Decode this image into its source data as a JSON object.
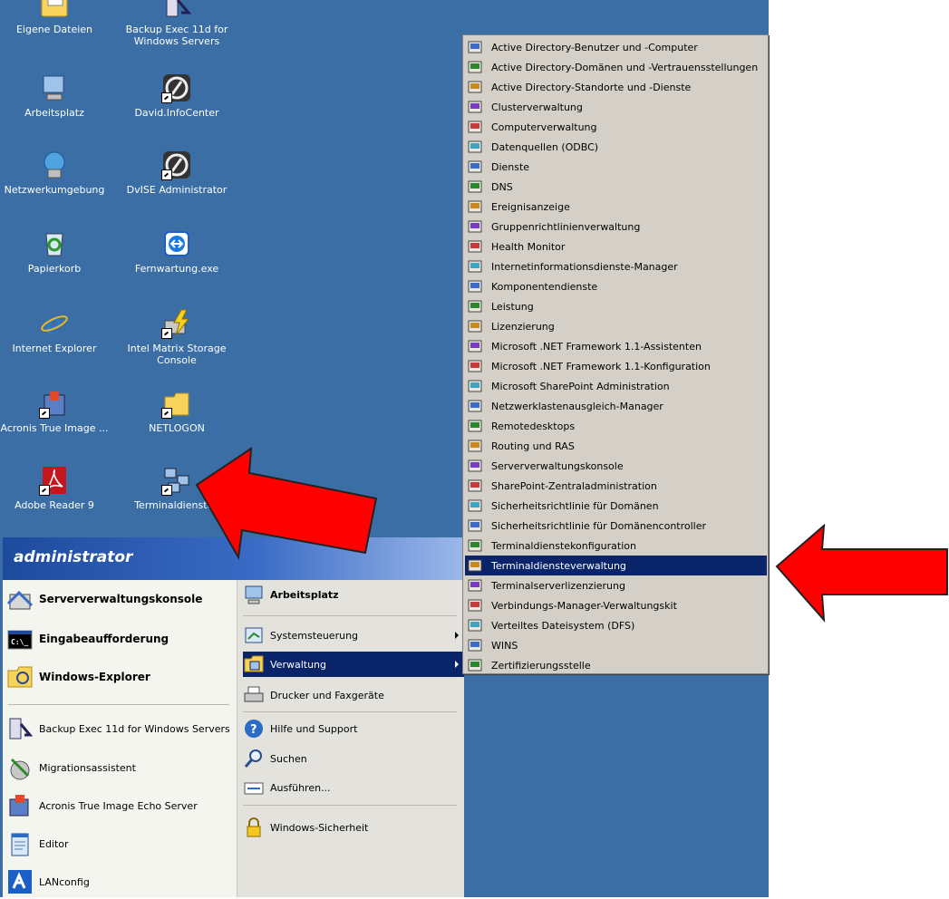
{
  "desktop": {
    "icons": [
      {
        "label": "Eigene Dateien",
        "icon": "folder-documents-icon"
      },
      {
        "label": "Backup Exec 11d for Windows Servers",
        "icon": "backup-exec-icon"
      },
      {
        "label": "Arbeitsplatz",
        "icon": "my-computer-icon"
      },
      {
        "label": "David.InfoCenter",
        "icon": "david-infocenter-icon"
      },
      {
        "label": "Netzwerkumgebung",
        "icon": "network-places-icon"
      },
      {
        "label": "DvISE Administrator",
        "icon": "dvise-admin-icon"
      },
      {
        "label": "Papierkorb",
        "icon": "recycle-bin-icon"
      },
      {
        "label": "Fernwartung.exe",
        "icon": "teamviewer-icon"
      },
      {
        "label": "Internet Explorer",
        "icon": "internet-explorer-icon"
      },
      {
        "label": "Intel Matrix Storage Console",
        "icon": "intel-storage-icon"
      },
      {
        "label": "Acronis True Image ...",
        "icon": "acronis-icon"
      },
      {
        "label": "NETLOGON",
        "icon": "folder-icon"
      },
      {
        "label": "Adobe Reader 9",
        "icon": "adobe-reader-icon"
      },
      {
        "label": "Terminaldienstev",
        "icon": "terminal-services-icon"
      }
    ]
  },
  "start_menu": {
    "user": "administrator",
    "left_items": [
      {
        "label": "Serververwaltungskonsole",
        "icon": "server-management-icon",
        "bold": true
      },
      {
        "label": "Eingabeaufforderung",
        "icon": "command-prompt-icon",
        "bold": true
      },
      {
        "label": "Windows-Explorer",
        "icon": "windows-explorer-icon",
        "bold": true
      },
      {
        "label": "Backup Exec 11d for Windows Servers",
        "icon": "backup-exec-icon",
        "bold": false
      },
      {
        "label": "Migrationsassistent",
        "icon": "migration-wizard-icon",
        "bold": false
      },
      {
        "label": "Acronis True Image Echo Server",
        "icon": "acronis-icon",
        "bold": false
      },
      {
        "label": "Editor",
        "icon": "notepad-icon",
        "bold": false
      },
      {
        "label": "LANconfig",
        "icon": "lanconfig-icon",
        "bold": false
      }
    ],
    "right_items": [
      {
        "label": "Arbeitsplatz",
        "icon": "my-computer-icon"
      },
      {
        "label": "Systemsteuerung",
        "icon": "control-panel-icon"
      },
      {
        "label": "Verwaltung",
        "icon": "admin-tools-icon"
      },
      {
        "label": "Drucker und Faxgeräte",
        "icon": "printer-icon"
      },
      {
        "label": "Hilfe und Support",
        "icon": "help-icon"
      },
      {
        "label": "Suchen",
        "icon": "search-icon"
      },
      {
        "label": "Ausführen...",
        "icon": "run-icon"
      },
      {
        "label": "Windows-Sicherheit",
        "icon": "windows-security-icon"
      }
    ]
  },
  "admin_tools_menu": {
    "items": [
      "Active Directory-Benutzer und -Computer",
      "Active Directory-Domänen und -Vertrauensstellungen",
      "Active Directory-Standorte und -Dienste",
      "Clusterverwaltung",
      "Computerverwaltung",
      "Datenquellen (ODBC)",
      "Dienste",
      "DNS",
      "Ereignisanzeige",
      "Gruppenrichtlinienverwaltung",
      "Health Monitor",
      "Internetinformationsdienste-Manager",
      "Komponentendienste",
      "Leistung",
      "Lizenzierung",
      "Microsoft .NET Framework 1.1-Assistenten",
      "Microsoft .NET Framework 1.1-Konfiguration",
      "Microsoft SharePoint Administration",
      "Netzwerklastenausgleich-Manager",
      "Remotedesktops",
      "Routing und RAS",
      "Serververwaltungskonsole",
      "SharePoint-Zentraladministration",
      "Sicherheitsrichtlinie für Domänen",
      "Sicherheitsrichtlinie für Domänencontroller",
      "Terminaldienstekonfiguration",
      "Terminaldiensteverwaltung",
      "Terminalserverlizenzierung",
      "Verbindungs-Manager-Verwaltungskit",
      "Verteiltes Dateisystem (DFS)",
      "WINS",
      "Zertifizierungsstelle"
    ],
    "selected": "Terminaldiensteverwaltung"
  },
  "colors": {
    "desktop": "#3a6ea5",
    "selection": "#0a246a",
    "arrow": "#ff0000"
  }
}
